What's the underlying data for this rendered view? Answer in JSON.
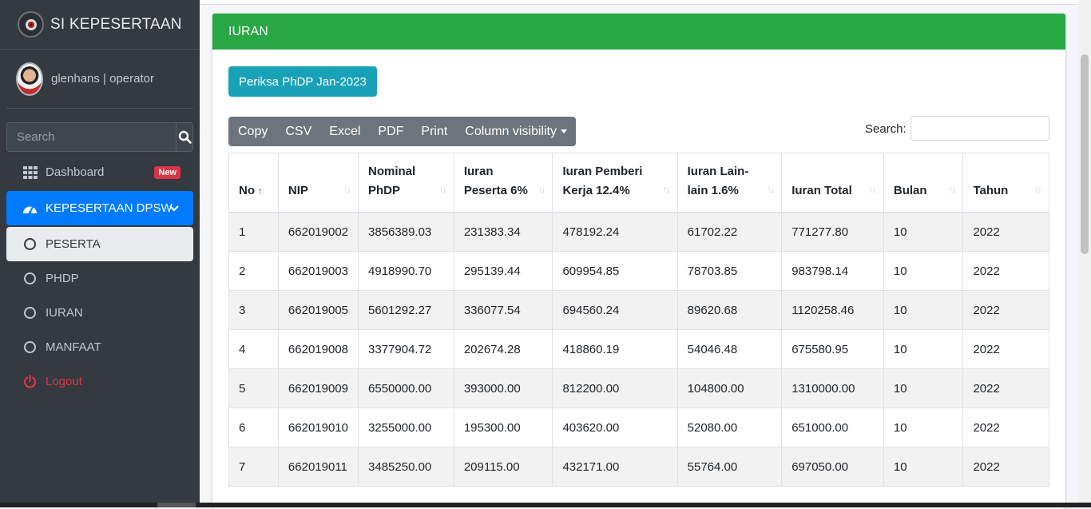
{
  "brand": {
    "title": "SI KEPESERTAAN",
    "logo_icon": "app-logo-icon"
  },
  "user": {
    "name": "glenhans | operator"
  },
  "sidebar_search": {
    "placeholder": "Search"
  },
  "nav": {
    "dashboard": {
      "label": "Dashboard",
      "badge": "New"
    },
    "kepesertaan": {
      "label": "KEPESERTAAN DPSW"
    },
    "peserta": {
      "label": "PESERTA"
    },
    "phdp": {
      "label": "PHDP"
    },
    "iuran": {
      "label": "IURAN"
    },
    "manfaat": {
      "label": "MANFAAT"
    },
    "logout": {
      "label": "Logout"
    }
  },
  "card": {
    "title": "IURAN",
    "check_button": "Periksa PhDP Jan-2023"
  },
  "export_buttons": [
    "Copy",
    "CSV",
    "Excel",
    "PDF",
    "Print",
    "Column visibility"
  ],
  "table_search": {
    "label": "Search:"
  },
  "table": {
    "headers": [
      {
        "lines": [
          "No"
        ],
        "sort": "asc"
      },
      {
        "lines": [
          "NIP"
        ],
        "sort": "none"
      },
      {
        "lines": [
          "Nominal",
          "PhDP"
        ],
        "sort": "none"
      },
      {
        "lines": [
          "Iuran",
          "Peserta 6%"
        ],
        "sort": "none"
      },
      {
        "lines": [
          "Iuran Pemberi",
          "Kerja 12.4%"
        ],
        "sort": "none"
      },
      {
        "lines": [
          "Iuran Lain-",
          "lain 1.6%"
        ],
        "sort": "none"
      },
      {
        "lines": [
          "Iuran Total"
        ],
        "sort": "none"
      },
      {
        "lines": [
          "Bulan"
        ],
        "sort": "none"
      },
      {
        "lines": [
          "Tahun"
        ],
        "sort": "none"
      }
    ],
    "rows": [
      [
        "1",
        "662019002",
        "3856389.03",
        "231383.34",
        "478192.24",
        "61702.22",
        "771277.80",
        "10",
        "2022"
      ],
      [
        "2",
        "662019003",
        "4918990.70",
        "295139.44",
        "609954.85",
        "78703.85",
        "983798.14",
        "10",
        "2022"
      ],
      [
        "3",
        "662019005",
        "5601292.27",
        "336077.54",
        "694560.24",
        "89620.68",
        "1120258.46",
        "10",
        "2022"
      ],
      [
        "4",
        "662019008",
        "3377904.72",
        "202674.28",
        "418860.19",
        "54046.48",
        "675580.95",
        "10",
        "2022"
      ],
      [
        "5",
        "662019009",
        "6550000.00",
        "393000.00",
        "812200.00",
        "104800.00",
        "1310000.00",
        "10",
        "2022"
      ],
      [
        "6",
        "662019010",
        "3255000.00",
        "195300.00",
        "403620.00",
        "52080.00",
        "651000.00",
        "10",
        "2022"
      ],
      [
        "7",
        "662019011",
        "3485250.00",
        "209115.00",
        "432171.00",
        "55764.00",
        "697050.00",
        "10",
        "2022"
      ]
    ]
  },
  "colors": {
    "header_green": "#28a745",
    "primary": "#007bff",
    "info": "#17a2b8",
    "danger": "#dc3545",
    "sidebar": "#343a40"
  }
}
